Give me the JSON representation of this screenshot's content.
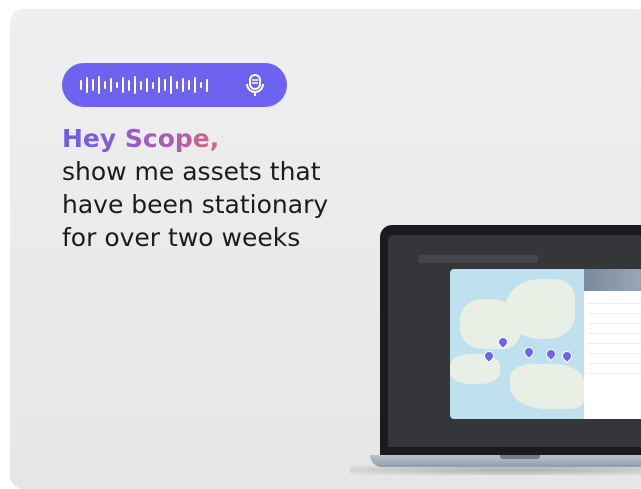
{
  "headline": {
    "greeting": "Hey Scope,",
    "lines": [
      "show me assets that",
      "have been stationary",
      "for over two weeks"
    ]
  },
  "voice_pill": {
    "icon": "microphone-icon",
    "color": "#6d63f0"
  },
  "colors": {
    "background": "#e9e9e9",
    "text": "#1c1c1c",
    "accent": "#6d63f0",
    "gradient_end": "#ef7f3a"
  }
}
